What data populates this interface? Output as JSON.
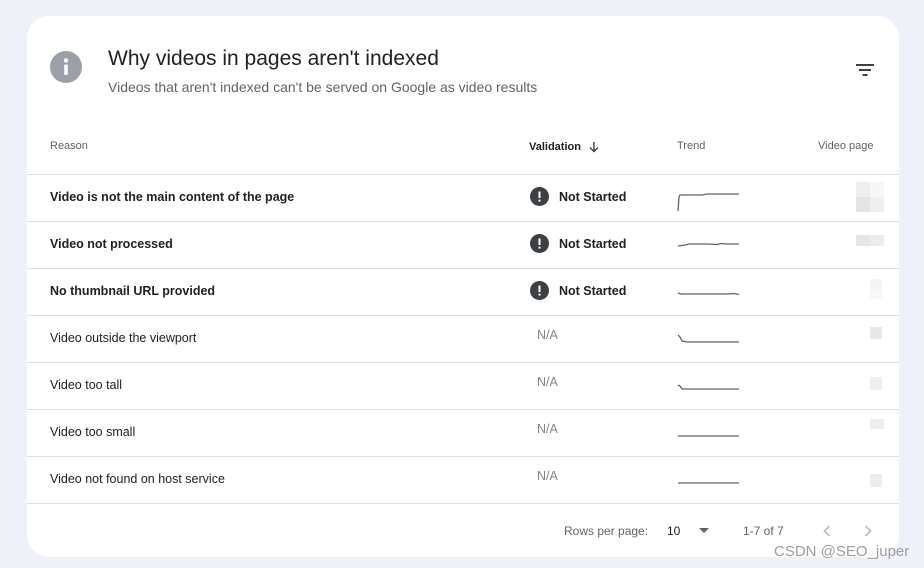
{
  "header": {
    "title": "Why videos in pages aren't indexed",
    "subtitle": "Videos that aren't indexed can't be served on Google as video results",
    "info_icon": "info-icon",
    "filter_icon": "filter-icon"
  },
  "table": {
    "columns": {
      "reason": "Reason",
      "validation": "Validation",
      "trend": "Trend",
      "video_page": "Video page"
    },
    "sort_icon": "arrow-down-icon",
    "rows": [
      {
        "reason": "Video is not the main content of the page",
        "validation": "Not Started"
      },
      {
        "reason": "Video not processed",
        "validation": "Not Started"
      },
      {
        "reason": "No thumbnail URL provided",
        "validation": "Not Started"
      },
      {
        "reason": "Video outside the viewport",
        "validation": "N/A"
      },
      {
        "reason": "Video too tall",
        "validation": "N/A"
      },
      {
        "reason": "Video too small",
        "validation": "N/A"
      },
      {
        "reason": "Video not found on host service",
        "validation": "N/A"
      }
    ]
  },
  "footer": {
    "rows_per_page_label": "Rows per page:",
    "rows_per_page_value": "10",
    "range": "1-7 of 7"
  },
  "watermark": "CSDN @SEO_juper",
  "colors": {
    "status_icon": "#3c4043",
    "sparkline": "#5f6368",
    "page_background": "#eef1f8"
  }
}
